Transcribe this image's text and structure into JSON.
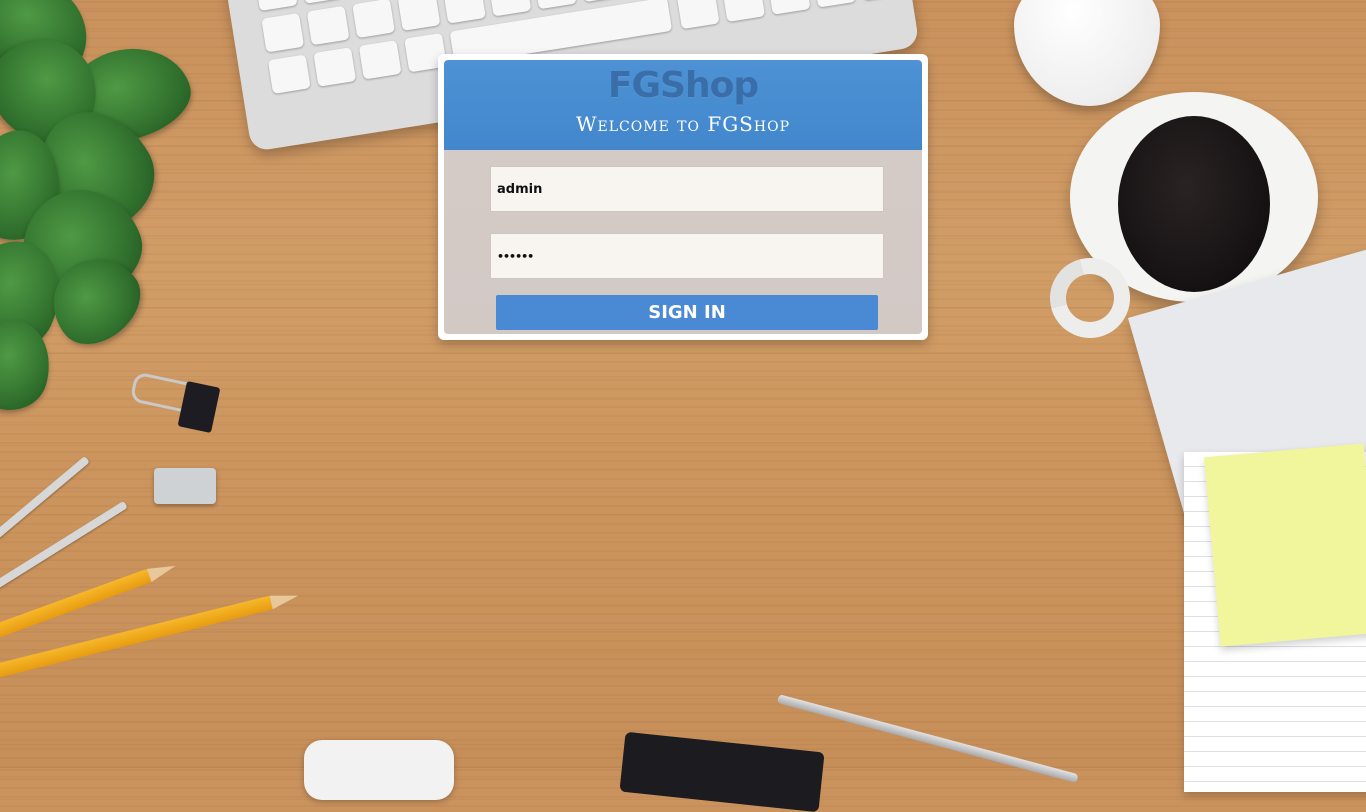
{
  "login": {
    "brand": "FGShop",
    "welcome": "Welcome to FGShop",
    "username_value": "admin",
    "password_value": "••••••",
    "sign_in_label": "SIGN IN"
  },
  "colors": {
    "header_blue": "#4287cc",
    "button_blue": "#4a89d4",
    "brand_text": "#3a6ea8",
    "panel_bg": "#d3cac6"
  }
}
